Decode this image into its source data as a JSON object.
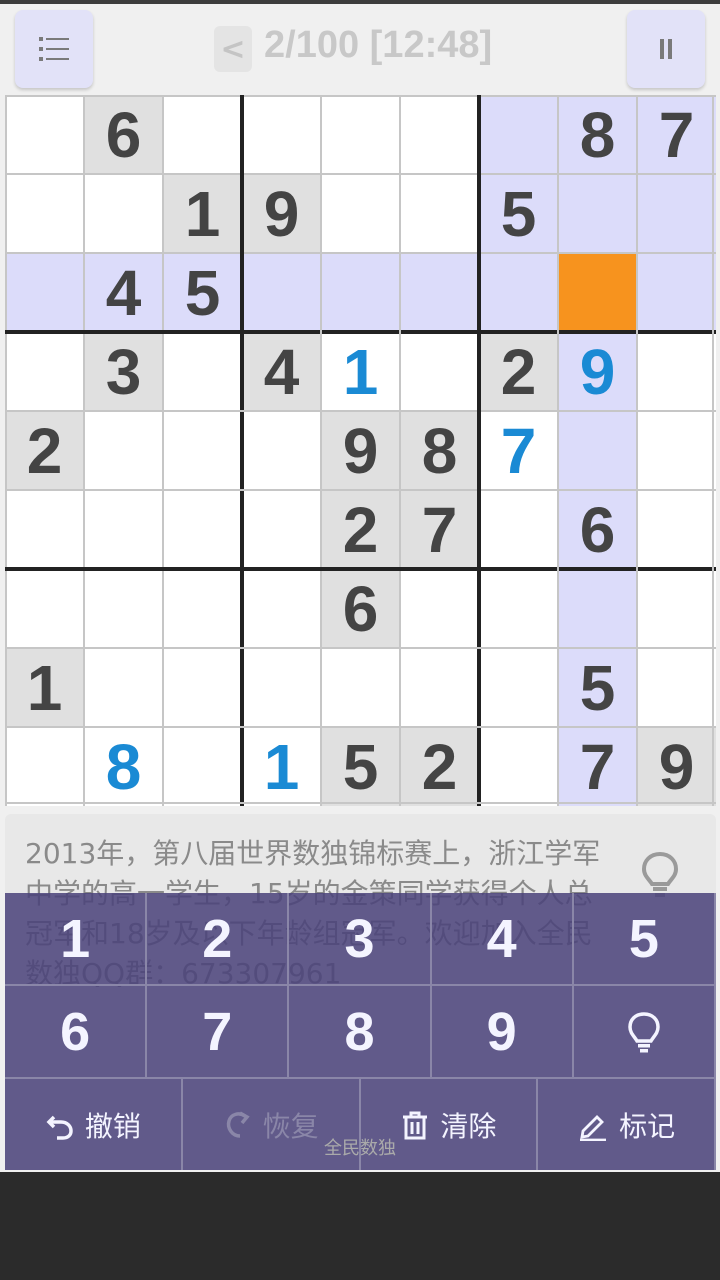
{
  "header": {
    "back_label": "<",
    "level_title": "2/100 [12:48]",
    "menu_icon": "list-menu-icon",
    "pause_icon": "pause-icon"
  },
  "board": {
    "rows": [
      [
        "",
        "6",
        "",
        "",
        "",
        "",
        "",
        "8",
        "7"
      ],
      [
        "",
        "",
        "1",
        "9",
        "",
        "",
        "5",
        "",
        ""
      ],
      [
        "",
        "4",
        "5",
        "",
        "",
        "",
        "",
        "",
        ""
      ],
      [
        "",
        "3",
        "",
        "4",
        "1",
        "",
        "2",
        "9",
        ""
      ],
      [
        "2",
        "",
        "",
        "",
        "9",
        "8",
        "7",
        "",
        ""
      ],
      [
        "",
        "",
        "",
        "",
        "2",
        "7",
        "",
        "6",
        ""
      ],
      [
        "",
        "",
        "",
        "",
        "6",
        "",
        "",
        "",
        ""
      ],
      [
        "1",
        "",
        "",
        "",
        "",
        "",
        "",
        "5",
        ""
      ],
      [
        "",
        "8",
        "",
        "1",
        "5",
        "2",
        "",
        "7",
        "9"
      ]
    ],
    "user_entered": [
      [
        3,
        4
      ],
      [
        3,
        7
      ],
      [
        4,
        6
      ],
      [
        8,
        1
      ],
      [
        8,
        3
      ]
    ],
    "selected": [
      2,
      7
    ],
    "colors": {
      "given_bg": "#e0e0e0",
      "highlight_bg": "#dcdcfa",
      "selected_bg": "#f7931e",
      "user_digit": "#1a8ad4",
      "given_digit": "#444444"
    }
  },
  "hint": {
    "text": "2013年，第八届世界数独锦标赛上，浙江学军中学的高一学生，15岁的金策同学获得个人总冠军和18岁及以下年龄组冠军。欢迎加入全民数独QQ群：673307961",
    "icon": "lightbulb-icon"
  },
  "keypad": {
    "digits": [
      "1",
      "2",
      "3",
      "4",
      "5",
      "6",
      "7",
      "8",
      "9"
    ],
    "hint_key_icon": "lightbulb-icon",
    "actions": [
      {
        "label": "撤销",
        "icon": "undo-icon",
        "enabled": true
      },
      {
        "label": "恢复",
        "icon": "redo-icon",
        "enabled": false
      },
      {
        "label": "清除",
        "icon": "trash-icon",
        "enabled": true
      },
      {
        "label": "标记",
        "icon": "pencil-icon",
        "enabled": true
      }
    ]
  },
  "footer": {
    "caption": "全民数独"
  }
}
